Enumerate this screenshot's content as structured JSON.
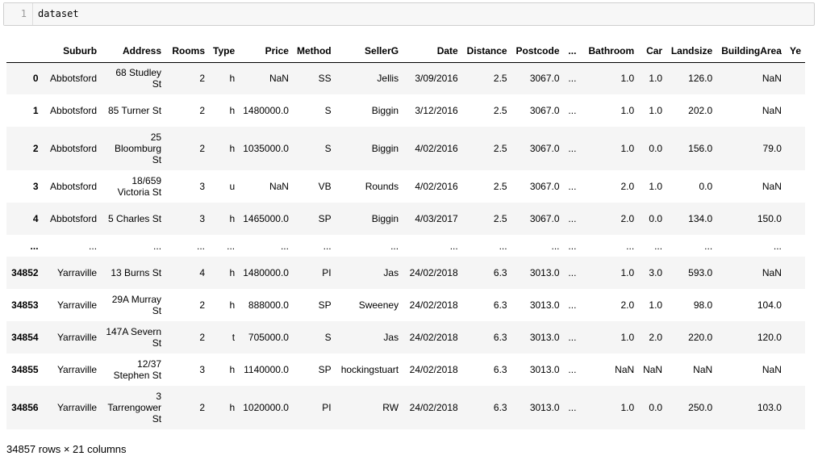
{
  "input": {
    "line_number": "1",
    "code": "dataset"
  },
  "table": {
    "index_header": "",
    "columns": [
      "Suburb",
      "Address",
      "Rooms",
      "Type",
      "Price",
      "Method",
      "SellerG",
      "Date",
      "Distance",
      "Postcode",
      "...",
      "Bathroom",
      "Car",
      "Landsize",
      "BuildingArea",
      "Ye"
    ],
    "rows": [
      {
        "index": "0",
        "cells": [
          "Abbotsford",
          "68 Studley St",
          "2",
          "h",
          "NaN",
          "SS",
          "Jellis",
          "3/09/2016",
          "2.5",
          "3067.0",
          "...",
          "1.0",
          "1.0",
          "126.0",
          "NaN",
          ""
        ]
      },
      {
        "index": "1",
        "cells": [
          "Abbotsford",
          "85 Turner St",
          "2",
          "h",
          "1480000.0",
          "S",
          "Biggin",
          "3/12/2016",
          "2.5",
          "3067.0",
          "...",
          "1.0",
          "1.0",
          "202.0",
          "NaN",
          ""
        ]
      },
      {
        "index": "2",
        "cells": [
          "Abbotsford",
          "25 Bloomburg St",
          "2",
          "h",
          "1035000.0",
          "S",
          "Biggin",
          "4/02/2016",
          "2.5",
          "3067.0",
          "...",
          "1.0",
          "0.0",
          "156.0",
          "79.0",
          ""
        ]
      },
      {
        "index": "3",
        "cells": [
          "Abbotsford",
          "18/659 Victoria St",
          "3",
          "u",
          "NaN",
          "VB",
          "Rounds",
          "4/02/2016",
          "2.5",
          "3067.0",
          "...",
          "2.0",
          "1.0",
          "0.0",
          "NaN",
          ""
        ]
      },
      {
        "index": "4",
        "cells": [
          "Abbotsford",
          "5 Charles St",
          "3",
          "h",
          "1465000.0",
          "SP",
          "Biggin",
          "4/03/2017",
          "2.5",
          "3067.0",
          "...",
          "2.0",
          "0.0",
          "134.0",
          "150.0",
          ""
        ]
      },
      {
        "index": "...",
        "cells": [
          "...",
          "...",
          "...",
          "...",
          "...",
          "...",
          "...",
          "...",
          "...",
          "...",
          "...",
          "...",
          "...",
          "...",
          "...",
          ""
        ]
      },
      {
        "index": "34852",
        "cells": [
          "Yarraville",
          "13 Burns St",
          "4",
          "h",
          "1480000.0",
          "PI",
          "Jas",
          "24/02/2018",
          "6.3",
          "3013.0",
          "...",
          "1.0",
          "3.0",
          "593.0",
          "NaN",
          ""
        ]
      },
      {
        "index": "34853",
        "cells": [
          "Yarraville",
          "29A Murray St",
          "2",
          "h",
          "888000.0",
          "SP",
          "Sweeney",
          "24/02/2018",
          "6.3",
          "3013.0",
          "...",
          "2.0",
          "1.0",
          "98.0",
          "104.0",
          ""
        ]
      },
      {
        "index": "34854",
        "cells": [
          "Yarraville",
          "147A Severn St",
          "2",
          "t",
          "705000.0",
          "S",
          "Jas",
          "24/02/2018",
          "6.3",
          "3013.0",
          "...",
          "1.0",
          "2.0",
          "220.0",
          "120.0",
          ""
        ]
      },
      {
        "index": "34855",
        "cells": [
          "Yarraville",
          "12/37 Stephen St",
          "3",
          "h",
          "1140000.0",
          "SP",
          "hockingstuart",
          "24/02/2018",
          "6.3",
          "3013.0",
          "...",
          "NaN",
          "NaN",
          "NaN",
          "NaN",
          ""
        ]
      },
      {
        "index": "34856",
        "cells": [
          "Yarraville",
          "3 Tarrengower St",
          "2",
          "h",
          "1020000.0",
          "PI",
          "RW",
          "24/02/2018",
          "6.3",
          "3013.0",
          "...",
          "1.0",
          "0.0",
          "250.0",
          "103.0",
          ""
        ]
      }
    ]
  },
  "footer": {
    "shape": "34857 rows × 21 columns"
  }
}
